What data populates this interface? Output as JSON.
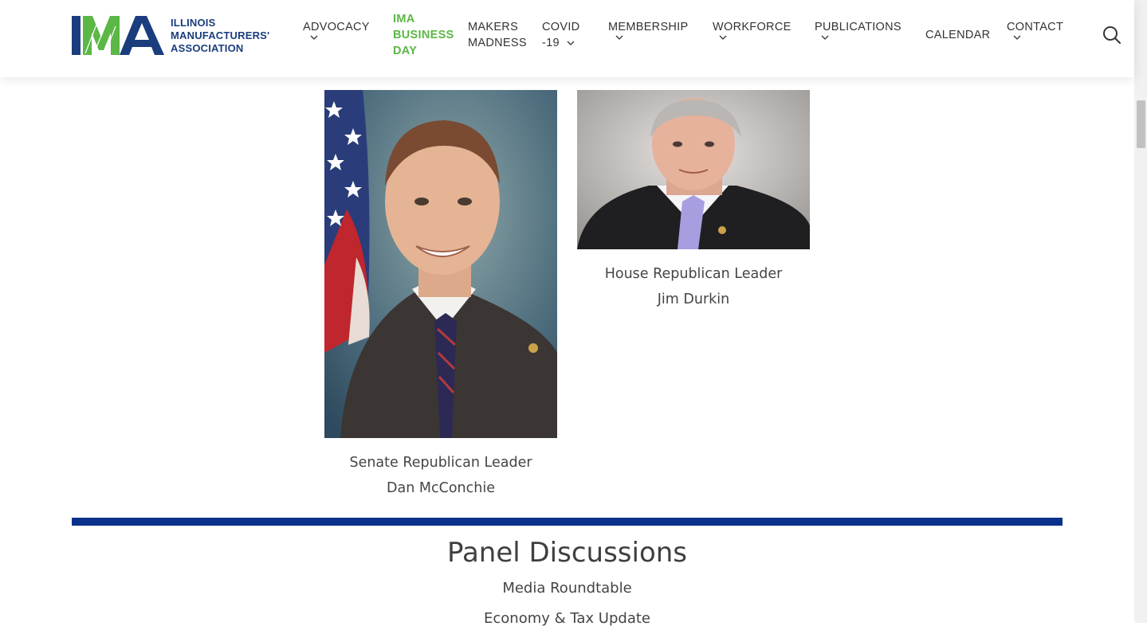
{
  "brand": {
    "logo_letters": "IMA",
    "name_lines": [
      "ILLINOIS",
      "MANUFACTURERS'",
      "ASSOCIATION"
    ],
    "colors": {
      "navy": "#1b3d7e",
      "green": "#5bb746",
      "divider": "#0a318b"
    }
  },
  "nav": {
    "advocacy": "ADVOCACY",
    "ima_business_day": [
      "IMA",
      "BUSINESS",
      "DAY"
    ],
    "makers_madness": [
      "MAKERS",
      "MADNESS"
    ],
    "covid": [
      "COVID",
      "-19"
    ],
    "membership": "MEMBERSHIP",
    "workforce": "WORKFORCE",
    "publications": "PUBLICATIONS",
    "calendar": "CALENDAR",
    "contact": "CONTACT",
    "search_icon": "search-icon",
    "dropdown_icon": "chevron-down-icon"
  },
  "leaders": [
    {
      "title": "Senate Republican Leader",
      "name": "Dan McConchie"
    },
    {
      "title": "House Republican Leader",
      "name": "Jim Durkin"
    }
  ],
  "panel": {
    "heading": "Panel Discussions",
    "items": [
      "Media Roundtable",
      "Economy & Tax Update"
    ]
  }
}
